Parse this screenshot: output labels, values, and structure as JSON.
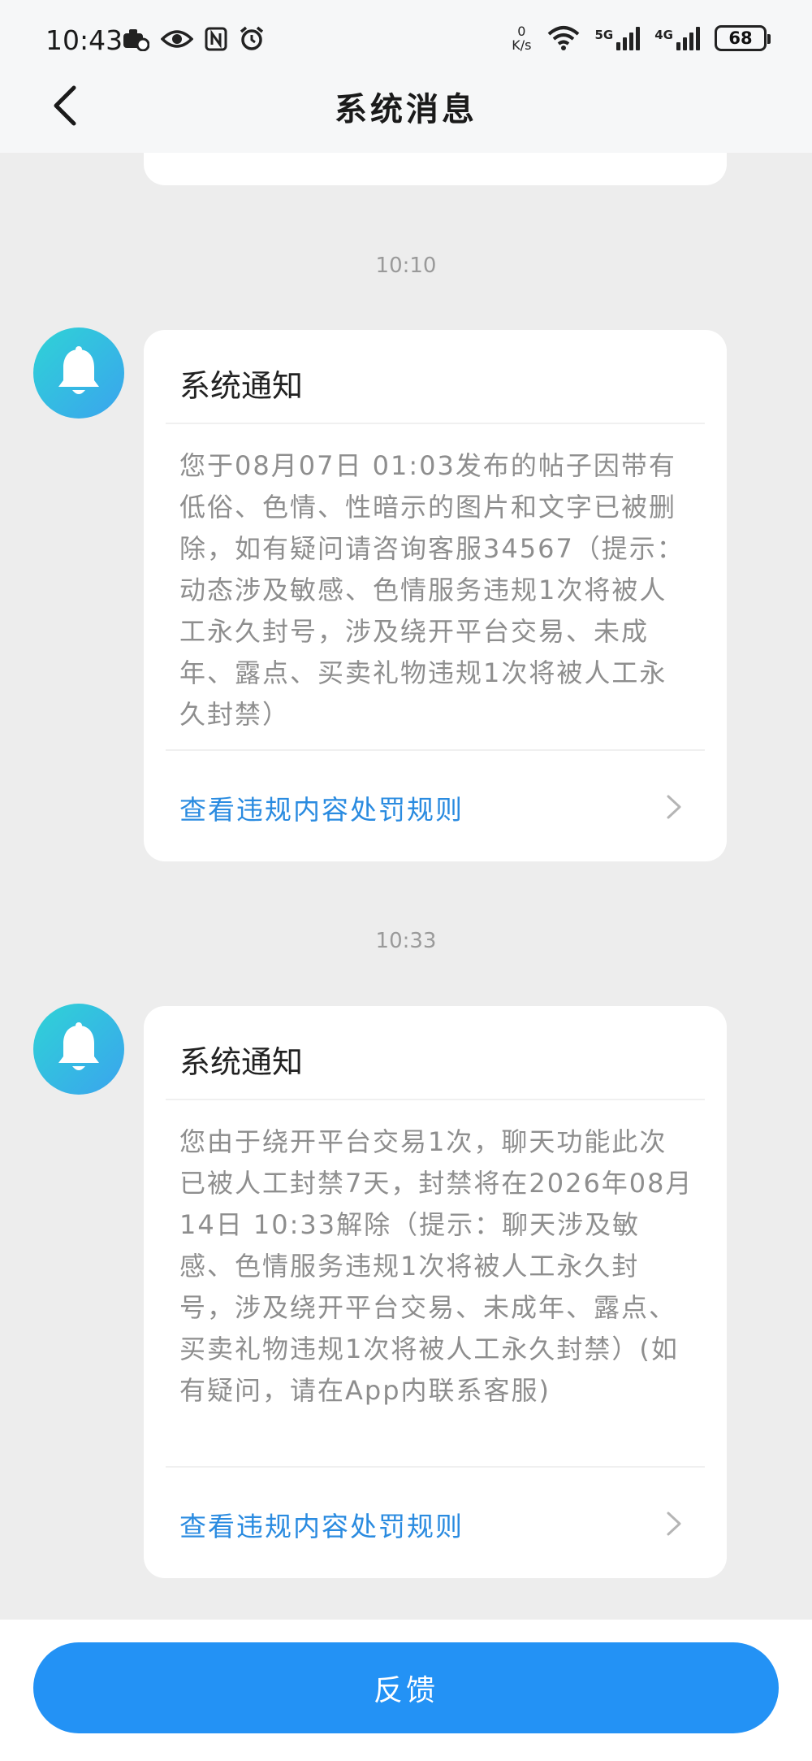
{
  "status_bar": {
    "time": "10:43",
    "net_speed_value": "0",
    "net_speed_unit": "K/s",
    "net1": "5G",
    "net2": "4G",
    "battery": "68"
  },
  "header": {
    "title": "系统消息"
  },
  "messages": [
    {
      "time": "10:10",
      "title": "系统通知",
      "body": "您于08月07日 01:03发布的帖子因带有低俗、色情、性暗示的图片和文字已被删除，如有疑问请咨询客服34567（提示：动态涉及敏感、色情服务违规1次将被人工永久封号，涉及绕开平台交易、未成年、露点、买卖礼物违规1次将被人工永久封禁）",
      "link": "查看违规内容处罚规则"
    },
    {
      "time": "10:33",
      "title": "系统通知",
      "body": "您由于绕开平台交易1次，聊天功能此次已被人工封禁7天，封禁将在2026年08月14日 10:33解除（提示：聊天涉及敏感、色情服务违规1次将被人工永久封号，涉及绕开平台交易、未成年、露点、买卖礼物违规1次将被人工永久封禁）(如有疑问，请在App内联系客服)",
      "link": "查看违规内容处罚规则"
    }
  ],
  "footer": {
    "feedback_label": "反馈"
  },
  "colors": {
    "accent": "#2392f5",
    "link": "#2a8be0",
    "background": "#ededed"
  }
}
